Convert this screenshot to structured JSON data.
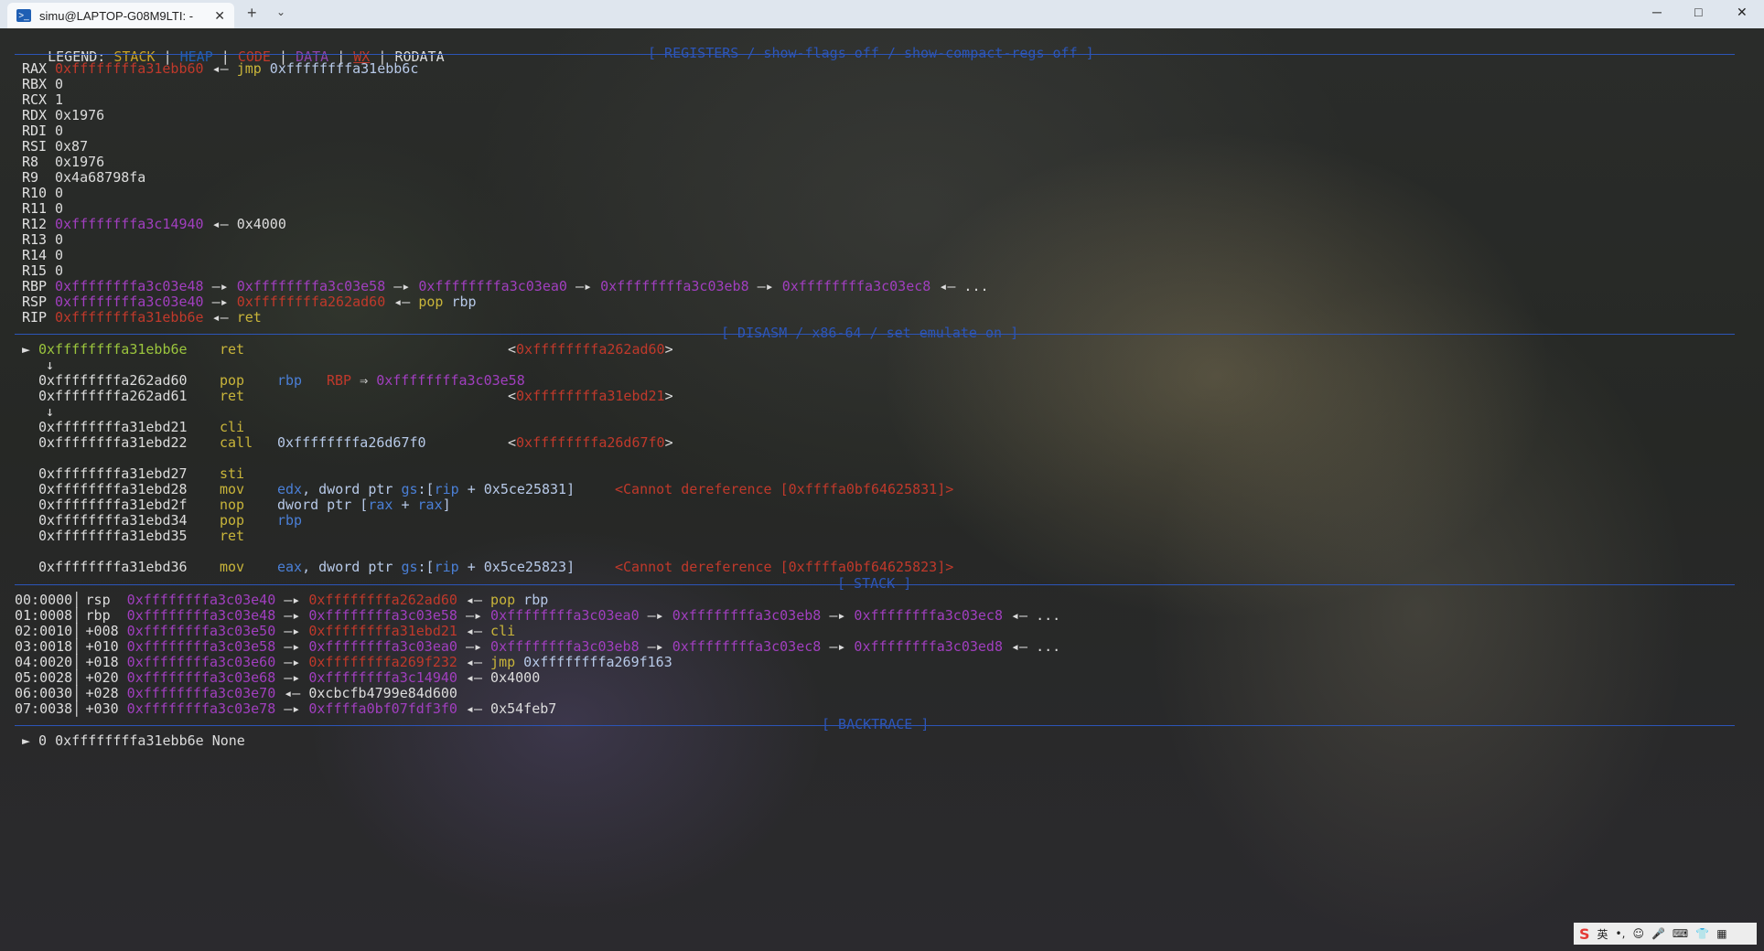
{
  "window": {
    "tab_title": "simu@LAPTOP-G08M9LTI: -",
    "tab_close": "✕",
    "new_tab": "+",
    "dropdown": "⌄",
    "minimize": "─",
    "maximize": "□",
    "close": "✕"
  },
  "legend": {
    "prefix": "LEGEND:",
    "stack": "STACK",
    "heap": "HEAP",
    "code": "CODE",
    "data": "DATA",
    "wx": "WX",
    "rodata": "RODATA",
    "bar": "|"
  },
  "sections": {
    "registers": "[ REGISTERS / show-flags off / show-compact-regs off ]",
    "disasm": "[ DISASM / x86-64 / set emulate on ]",
    "stack": "[ STACK ]",
    "backtrace": "[ BACKTRACE ]"
  },
  "registers": [
    {
      "name": "RAX",
      "parts": [
        {
          "t": "0xffffffffa31ebb60",
          "c": "red"
        },
        {
          "t": " ◂— ",
          "c": "arrow"
        },
        {
          "t": "jmp",
          "c": "yel"
        },
        {
          "t": " 0xffffffffa31ebb6c",
          "c": "ops"
        }
      ]
    },
    {
      "name": "RBX",
      "parts": [
        {
          "t": "0",
          "c": "num"
        }
      ]
    },
    {
      "name": "RCX",
      "parts": [
        {
          "t": "1",
          "c": "num"
        }
      ]
    },
    {
      "name": "RDX",
      "parts": [
        {
          "t": "0x1976",
          "c": "num"
        }
      ]
    },
    {
      "name": "RDI",
      "parts": [
        {
          "t": "0",
          "c": "num"
        }
      ]
    },
    {
      "name": "RSI",
      "parts": [
        {
          "t": "0x87",
          "c": "num"
        }
      ]
    },
    {
      "name": "R8",
      "parts": [
        {
          "t": "0x1976",
          "c": "num"
        }
      ]
    },
    {
      "name": "R9",
      "parts": [
        {
          "t": "0x4a68798fa",
          "c": "num"
        }
      ]
    },
    {
      "name": "R10",
      "parts": [
        {
          "t": "0",
          "c": "num"
        }
      ]
    },
    {
      "name": "R11",
      "parts": [
        {
          "t": "0",
          "c": "num"
        }
      ]
    },
    {
      "name": "R12",
      "parts": [
        {
          "t": "0xffffffffa3c14940",
          "c": "mag"
        },
        {
          "t": " ◂— ",
          "c": "arrow"
        },
        {
          "t": "0x4000",
          "c": "num"
        }
      ]
    },
    {
      "name": "R13",
      "parts": [
        {
          "t": "0",
          "c": "num"
        }
      ]
    },
    {
      "name": "R14",
      "parts": [
        {
          "t": "0",
          "c": "num"
        }
      ]
    },
    {
      "name": "R15",
      "parts": [
        {
          "t": "0",
          "c": "num"
        }
      ]
    },
    {
      "name": "RBP",
      "parts": [
        {
          "t": "0xffffffffa3c03e48",
          "c": "mag"
        },
        {
          "t": " —▸ ",
          "c": "arrow"
        },
        {
          "t": "0xffffffffa3c03e58",
          "c": "mag"
        },
        {
          "t": " —▸ ",
          "c": "arrow"
        },
        {
          "t": "0xffffffffa3c03ea0",
          "c": "mag"
        },
        {
          "t": " —▸ ",
          "c": "arrow"
        },
        {
          "t": "0xffffffffa3c03eb8",
          "c": "mag"
        },
        {
          "t": " —▸ ",
          "c": "arrow"
        },
        {
          "t": "0xffffffffa3c03ec8",
          "c": "mag"
        },
        {
          "t": " ◂— ...",
          "c": "arrow"
        }
      ]
    },
    {
      "name": "RSP",
      "parts": [
        {
          "t": "0xffffffffa3c03e40",
          "c": "mag"
        },
        {
          "t": " —▸ ",
          "c": "arrow"
        },
        {
          "t": "0xffffffffa262ad60",
          "c": "red"
        },
        {
          "t": " ◂— ",
          "c": "arrow"
        },
        {
          "t": "pop",
          "c": "yel"
        },
        {
          "t": " rbp",
          "c": "ops"
        }
      ]
    },
    {
      "name": "RIP",
      "parts": [
        {
          "t": "0xffffffffa31ebb6e",
          "c": "red"
        },
        {
          "t": " ◂— ",
          "c": "arrow"
        },
        {
          "t": "ret",
          "c": "yel"
        }
      ]
    }
  ],
  "disasm": [
    {
      "mark": "►",
      "addr": "0xffffffffa31ebb6e",
      "cur": true,
      "mn": "ret",
      "ops": [],
      "note": [
        {
          "t": "<",
          "c": "arrow"
        },
        {
          "t": "0xffffffffa262ad60",
          "c": "red"
        },
        {
          "t": ">",
          "c": "arrow"
        }
      ]
    },
    {
      "mark": "↓",
      "arrow_only": true
    },
    {
      "mark": "",
      "addr": "0xffffffffa262ad60",
      "mn": "pop",
      "ops": [
        {
          "t": "rbp",
          "c": "blu"
        }
      ],
      "mid": [
        {
          "t": "RBP",
          "c": "red"
        },
        {
          "t": " ⇒ ",
          "c": "arrow"
        },
        {
          "t": "0xffffffffa3c03e58",
          "c": "mag"
        }
      ]
    },
    {
      "mark": "",
      "addr": "0xffffffffa262ad61",
      "mn": "ret",
      "ops": [],
      "note": [
        {
          "t": "<",
          "c": "arrow"
        },
        {
          "t": "0xffffffffa31ebd21",
          "c": "red"
        },
        {
          "t": ">",
          "c": "arrow"
        }
      ]
    },
    {
      "mark": "↓",
      "arrow_only": true
    },
    {
      "mark": "",
      "addr": "0xffffffffa31ebd21",
      "mn": "cli",
      "ops": []
    },
    {
      "mark": "",
      "addr": "0xffffffffa31ebd22",
      "mn": "call",
      "ops": [
        {
          "t": "0xffffffffa26d67f0",
          "c": "ops"
        }
      ],
      "note": [
        {
          "t": "<",
          "c": "arrow"
        },
        {
          "t": "0xffffffffa26d67f0",
          "c": "red"
        },
        {
          "t": ">",
          "c": "arrow"
        }
      ]
    },
    {
      "blank": true
    },
    {
      "mark": "",
      "addr": "0xffffffffa31ebd27",
      "mn": "sti",
      "ops": []
    },
    {
      "mark": "",
      "addr": "0xffffffffa31ebd28",
      "mn": "mov",
      "ops": [
        {
          "t": "edx",
          "c": "blu"
        },
        {
          "t": ", dword ptr ",
          "c": "ops"
        },
        {
          "t": "gs",
          "c": "blu"
        },
        {
          "t": ":[",
          "c": "ops"
        },
        {
          "t": "rip",
          "c": "blu"
        },
        {
          "t": " + 0x5ce25831]",
          "c": "ops"
        }
      ],
      "note2": [
        {
          "t": "<Cannot dereference [0xffffa0bf64625831]>",
          "c": "red"
        }
      ]
    },
    {
      "mark": "",
      "addr": "0xffffffffa31ebd2f",
      "mn": "nop",
      "ops": [
        {
          "t": "dword ptr [",
          "c": "ops"
        },
        {
          "t": "rax",
          "c": "blu"
        },
        {
          "t": " + ",
          "c": "ops"
        },
        {
          "t": "rax",
          "c": "blu"
        },
        {
          "t": "]",
          "c": "ops"
        }
      ]
    },
    {
      "mark": "",
      "addr": "0xffffffffa31ebd34",
      "mn": "pop",
      "ops": [
        {
          "t": "rbp",
          "c": "blu"
        }
      ]
    },
    {
      "mark": "",
      "addr": "0xffffffffa31ebd35",
      "mn": "ret",
      "ops": []
    },
    {
      "blank": true
    },
    {
      "mark": "",
      "addr": "0xffffffffa31ebd36",
      "mn": "mov",
      "ops": [
        {
          "t": "eax",
          "c": "blu"
        },
        {
          "t": ", dword ptr ",
          "c": "ops"
        },
        {
          "t": "gs",
          "c": "blu"
        },
        {
          "t": ":[",
          "c": "ops"
        },
        {
          "t": "rip",
          "c": "blu"
        },
        {
          "t": " + 0x5ce25823]",
          "c": "ops"
        }
      ],
      "note2": [
        {
          "t": "<Cannot dereference [0xffffa0bf64625823]>",
          "c": "red"
        }
      ]
    }
  ],
  "stack": [
    {
      "idx": "00:0000",
      "reg": "rsp ",
      "parts": [
        {
          "t": "0xffffffffa3c03e40",
          "c": "mag"
        },
        {
          "t": " —▸ ",
          "c": "arrow"
        },
        {
          "t": "0xffffffffa262ad60",
          "c": "red"
        },
        {
          "t": " ◂— ",
          "c": "arrow"
        },
        {
          "t": "pop",
          "c": "yel"
        },
        {
          "t": " rbp",
          "c": "ops"
        }
      ]
    },
    {
      "idx": "01:0008",
      "reg": "rbp ",
      "parts": [
        {
          "t": "0xffffffffa3c03e48",
          "c": "mag"
        },
        {
          "t": " —▸ ",
          "c": "arrow"
        },
        {
          "t": "0xffffffffa3c03e58",
          "c": "mag"
        },
        {
          "t": " —▸ ",
          "c": "arrow"
        },
        {
          "t": "0xffffffffa3c03ea0",
          "c": "mag"
        },
        {
          "t": " —▸ ",
          "c": "arrow"
        },
        {
          "t": "0xffffffffa3c03eb8",
          "c": "mag"
        },
        {
          "t": " —▸ ",
          "c": "arrow"
        },
        {
          "t": "0xffffffffa3c03ec8",
          "c": "mag"
        },
        {
          "t": " ◂— ...",
          "c": "arrow"
        }
      ]
    },
    {
      "idx": "02:0010",
      "reg": "+008",
      "parts": [
        {
          "t": "0xffffffffa3c03e50",
          "c": "mag"
        },
        {
          "t": " —▸ ",
          "c": "arrow"
        },
        {
          "t": "0xffffffffa31ebd21",
          "c": "red"
        },
        {
          "t": " ◂— ",
          "c": "arrow"
        },
        {
          "t": "cli",
          "c": "yel"
        }
      ]
    },
    {
      "idx": "03:0018",
      "reg": "+010",
      "parts": [
        {
          "t": "0xffffffffa3c03e58",
          "c": "mag"
        },
        {
          "t": " —▸ ",
          "c": "arrow"
        },
        {
          "t": "0xffffffffa3c03ea0",
          "c": "mag"
        },
        {
          "t": " —▸ ",
          "c": "arrow"
        },
        {
          "t": "0xffffffffa3c03eb8",
          "c": "mag"
        },
        {
          "t": " —▸ ",
          "c": "arrow"
        },
        {
          "t": "0xffffffffa3c03ec8",
          "c": "mag"
        },
        {
          "t": " —▸ ",
          "c": "arrow"
        },
        {
          "t": "0xffffffffa3c03ed8",
          "c": "mag"
        },
        {
          "t": " ◂— ...",
          "c": "arrow"
        }
      ]
    },
    {
      "idx": "04:0020",
      "reg": "+018",
      "parts": [
        {
          "t": "0xffffffffa3c03e60",
          "c": "mag"
        },
        {
          "t": " —▸ ",
          "c": "arrow"
        },
        {
          "t": "0xffffffffa269f232",
          "c": "red"
        },
        {
          "t": " ◂— ",
          "c": "arrow"
        },
        {
          "t": "jmp",
          "c": "yel"
        },
        {
          "t": " 0xffffffffa269f163",
          "c": "ops"
        }
      ]
    },
    {
      "idx": "05:0028",
      "reg": "+020",
      "parts": [
        {
          "t": "0xffffffffa3c03e68",
          "c": "mag"
        },
        {
          "t": " —▸ ",
          "c": "arrow"
        },
        {
          "t": "0xffffffffa3c14940",
          "c": "mag"
        },
        {
          "t": " ◂— ",
          "c": "arrow"
        },
        {
          "t": "0x4000",
          "c": "num"
        }
      ]
    },
    {
      "idx": "06:0030",
      "reg": "+028",
      "parts": [
        {
          "t": "0xffffffffa3c03e70",
          "c": "mag"
        },
        {
          "t": " ◂— ",
          "c": "arrow"
        },
        {
          "t": "0xcbcfb4799e84d600",
          "c": "num"
        }
      ]
    },
    {
      "idx": "07:0038",
      "reg": "+030",
      "parts": [
        {
          "t": "0xffffffffa3c03e78",
          "c": "mag"
        },
        {
          "t": " —▸ ",
          "c": "arrow"
        },
        {
          "t": "0xffffa0bf07fdf3f0",
          "c": "mag"
        },
        {
          "t": " ◂— ",
          "c": "arrow"
        },
        {
          "t": "0x54feb7",
          "c": "num"
        }
      ]
    }
  ],
  "backtrace": [
    {
      "mark": "►",
      "text": " 0 0xffffffffa31ebb6e None"
    }
  ],
  "tray": {
    "logo": "S",
    "ime": "英",
    "items": [
      "•,",
      "☺",
      "🎤",
      "⌨",
      "👕",
      "▦"
    ]
  }
}
